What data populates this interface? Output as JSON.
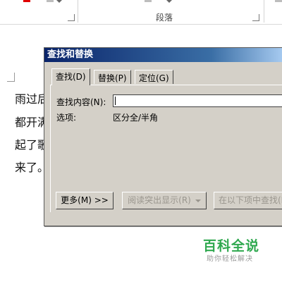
{
  "ribbon": {
    "group_label": "段落"
  },
  "document": {
    "lines": [
      "雨过后",
      "都开满",
      "起了歌",
      "来了。"
    ]
  },
  "dialog": {
    "title": "查找和替换",
    "tabs": [
      {
        "label": "查找(D)",
        "active": true
      },
      {
        "label": "替换(P)",
        "active": false
      },
      {
        "label": "定位(G)",
        "active": false
      }
    ],
    "find_label": "查找内容(N):",
    "find_value": "",
    "options_label": "选项:",
    "options_value": "区分全/半角",
    "buttons": {
      "more": "更多(M) >>",
      "reading_highlight": "阅读突出显示(R)",
      "find_in": "在以下项中查找(I)"
    }
  },
  "watermark": {
    "title": "百科全说",
    "subtitle": "助你轻松解决"
  },
  "colors": {
    "titlebar_start": "#0a246a",
    "dialog_face": "#d4d0c8",
    "watermark_green": "#2fa84f"
  }
}
